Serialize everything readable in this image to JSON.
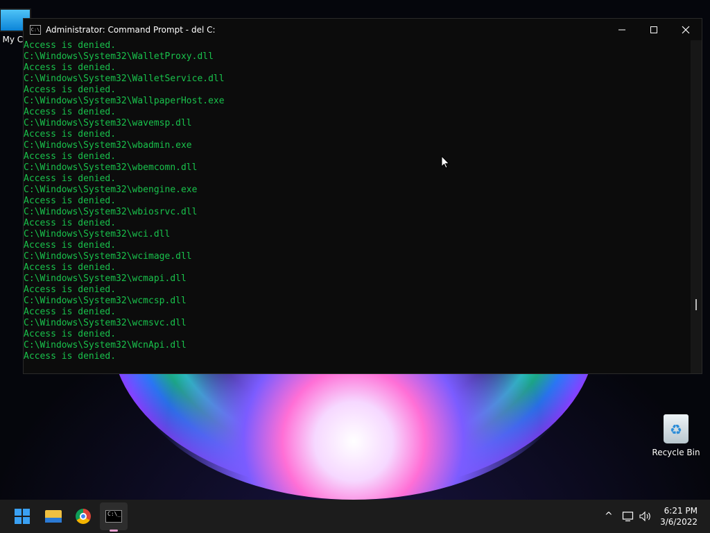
{
  "desktop": {
    "icons": [
      {
        "label": "My Co"
      },
      {
        "label": "Recycle Bin"
      }
    ]
  },
  "window": {
    "title": "Administrator: Command Prompt - del  C:",
    "controls": {
      "minimize_icon": "minimize-icon",
      "maximize_icon": "maximize-icon",
      "close_icon": "close-icon"
    }
  },
  "console": {
    "text_color": "#19c24c",
    "lines": [
      "Access is denied.",
      "C:\\Windows\\System32\\WalletProxy.dll",
      "Access is denied.",
      "C:\\Windows\\System32\\WalletService.dll",
      "Access is denied.",
      "C:\\Windows\\System32\\WallpaperHost.exe",
      "Access is denied.",
      "C:\\Windows\\System32\\wavemsp.dll",
      "Access is denied.",
      "C:\\Windows\\System32\\wbadmin.exe",
      "Access is denied.",
      "C:\\Windows\\System32\\wbemcomn.dll",
      "Access is denied.",
      "C:\\Windows\\System32\\wbengine.exe",
      "Access is denied.",
      "C:\\Windows\\System32\\wbiosrvc.dll",
      "Access is denied.",
      "C:\\Windows\\System32\\wci.dll",
      "Access is denied.",
      "C:\\Windows\\System32\\wcimage.dll",
      "Access is denied.",
      "C:\\Windows\\System32\\wcmapi.dll",
      "Access is denied.",
      "C:\\Windows\\System32\\wcmcsp.dll",
      "Access is denied.",
      "C:\\Windows\\System32\\wcmsvc.dll",
      "Access is denied.",
      "C:\\Windows\\System32\\WcnApi.dll",
      "Access is denied."
    ]
  },
  "taskbar": {
    "apps": [
      {
        "name": "start",
        "icon": "windows-logo-icon"
      },
      {
        "name": "file-explorer",
        "icon": "folder-icon"
      },
      {
        "name": "chrome",
        "icon": "chrome-icon"
      },
      {
        "name": "command-prompt",
        "icon": "terminal-icon",
        "active": true
      }
    ],
    "tray": {
      "chevron": "^",
      "network_icon": "network-icon",
      "volume_icon": "volume-icon"
    },
    "clock": {
      "time": "6:21 PM",
      "date": "3/6/2022"
    }
  }
}
